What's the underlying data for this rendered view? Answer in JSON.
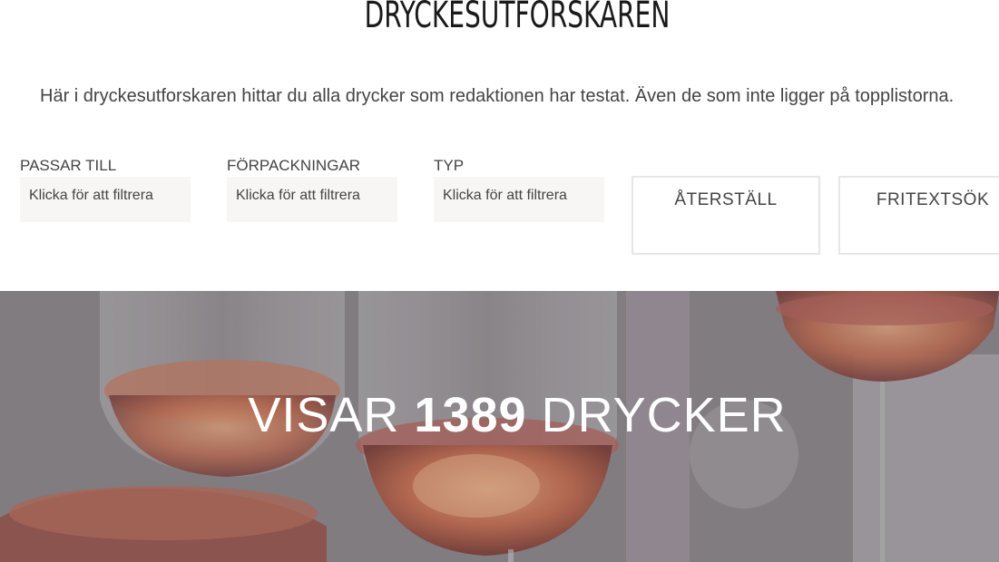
{
  "page": {
    "title": "DRYCKESUTFORSKAREN",
    "intro": "Här i dryckesutforskaren hittar du alla drycker som redaktionen har testat. Även de som inte ligger på topplistorna."
  },
  "filters": [
    {
      "label": "PASSAR TILL",
      "placeholder": "Klicka för att filtrera"
    },
    {
      "label": "FÖRPACKNINGAR",
      "placeholder": "Klicka för att filtrera"
    },
    {
      "label": "TYP",
      "placeholder": "Klicka för att filtrera"
    }
  ],
  "actions": {
    "reset_label": "ÅTERSTÄLL",
    "freetext_label": "FRITEXTSÖK"
  },
  "hero": {
    "prefix": "VISAR",
    "count": "1389",
    "suffix": "DRYCKER"
  }
}
